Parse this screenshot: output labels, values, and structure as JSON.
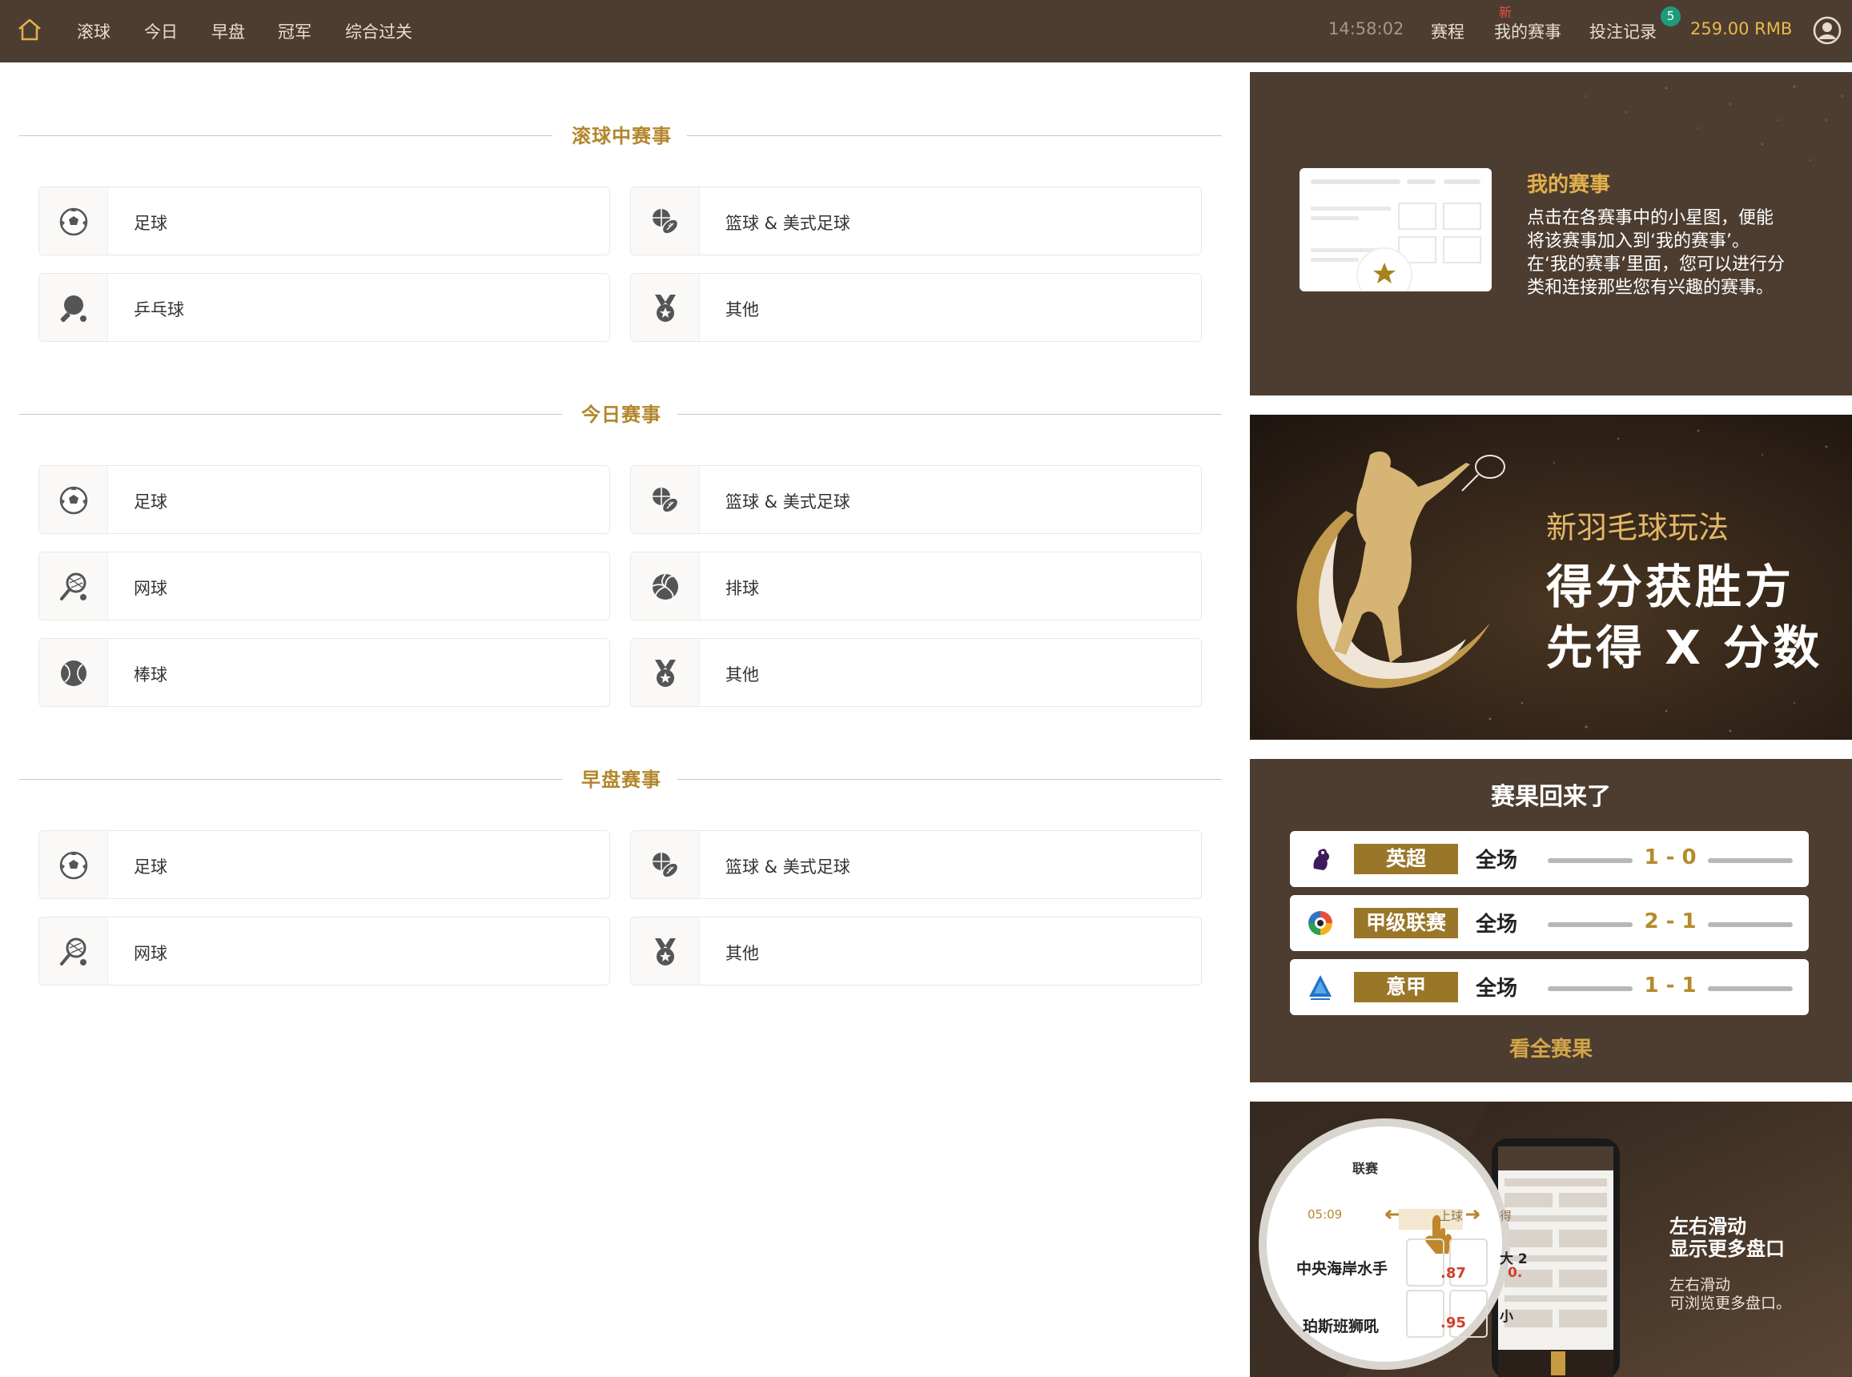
{
  "header": {
    "nav": [
      "滚球",
      "今日",
      "早盘",
      "冠军",
      "综合过关"
    ],
    "clock": "14:58:02",
    "schedule": "赛程",
    "my_events": "我的赛事",
    "new_tag": "新",
    "bet_record": "投注记录",
    "bet_badge": "5",
    "balance": "259.00 RMB"
  },
  "sections": {
    "live": {
      "title": "滚球中赛事",
      "items": [
        "足球",
        "篮球 & 美式足球",
        "乒乓球",
        "其他"
      ]
    },
    "today": {
      "title": "今日赛事",
      "items": [
        "足球",
        "篮球 & 美式足球",
        "网球",
        "排球",
        "棒球",
        "其他"
      ]
    },
    "early": {
      "title": "早盘赛事",
      "items": [
        "足球",
        "篮球 & 美式足球",
        "网球",
        "其他"
      ]
    }
  },
  "promo_my_events": {
    "title": "我的赛事",
    "lines": [
      "点击在各赛事中的小星图，便能",
      "将该赛事加入到‘我的赛事’。",
      "在‘我的赛事’里面，您可以进行分",
      "类和连接那些您有兴趣的赛事。"
    ]
  },
  "promo_badminton": {
    "subtitle": "新羽毛球玩法",
    "line1": "得分获胜方",
    "line2": "先得 X 分数"
  },
  "results": {
    "heading": "赛果回来了",
    "rows": [
      {
        "league": "英超",
        "period": "全场",
        "score": "1 - 0"
      },
      {
        "league": "甲级联赛",
        "period": "全场",
        "score": "2 - 1"
      },
      {
        "league": "意甲",
        "period": "全场",
        "score": "1 - 1"
      }
    ],
    "more": "看全赛果"
  },
  "promo_swipe": {
    "title1": "左右滑动",
    "title2": "显示更多盘口",
    "sub1": "左右滑动",
    "sub2": "可浏览更多盘口。",
    "magnifier": {
      "league": "联赛",
      "time": "05:09",
      "tab": "上球",
      "tab2": "得",
      "team1": "中央海岸水手",
      "team2": "珀斯班狮吼",
      "odd1": ".87",
      "odd2": ".95",
      "big": "大 2",
      "big_odd": "0.",
      "small": "小"
    }
  }
}
